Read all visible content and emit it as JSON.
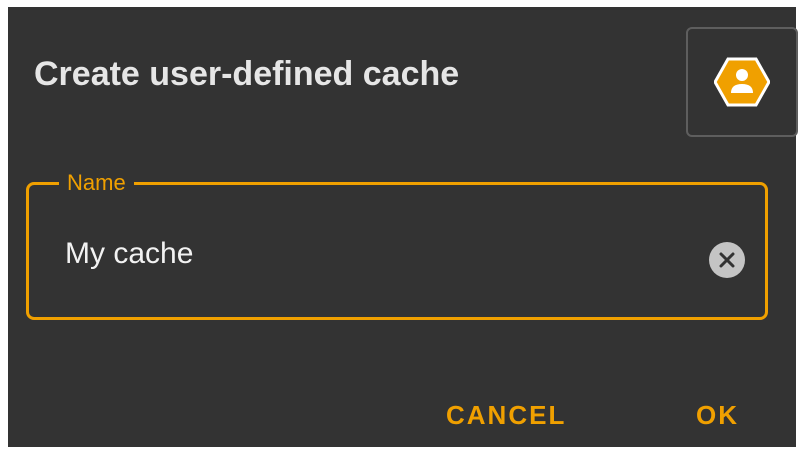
{
  "dialog": {
    "title": "Create user-defined cache",
    "type_icon": "user-hexagon-icon",
    "accent_color": "#f0a000",
    "background_color": "#333333"
  },
  "name_field": {
    "label": "Name",
    "value": "My cache",
    "clear_icon": "clear-circle-icon"
  },
  "actions": {
    "cancel_label": "CANCEL",
    "ok_label": "OK"
  }
}
